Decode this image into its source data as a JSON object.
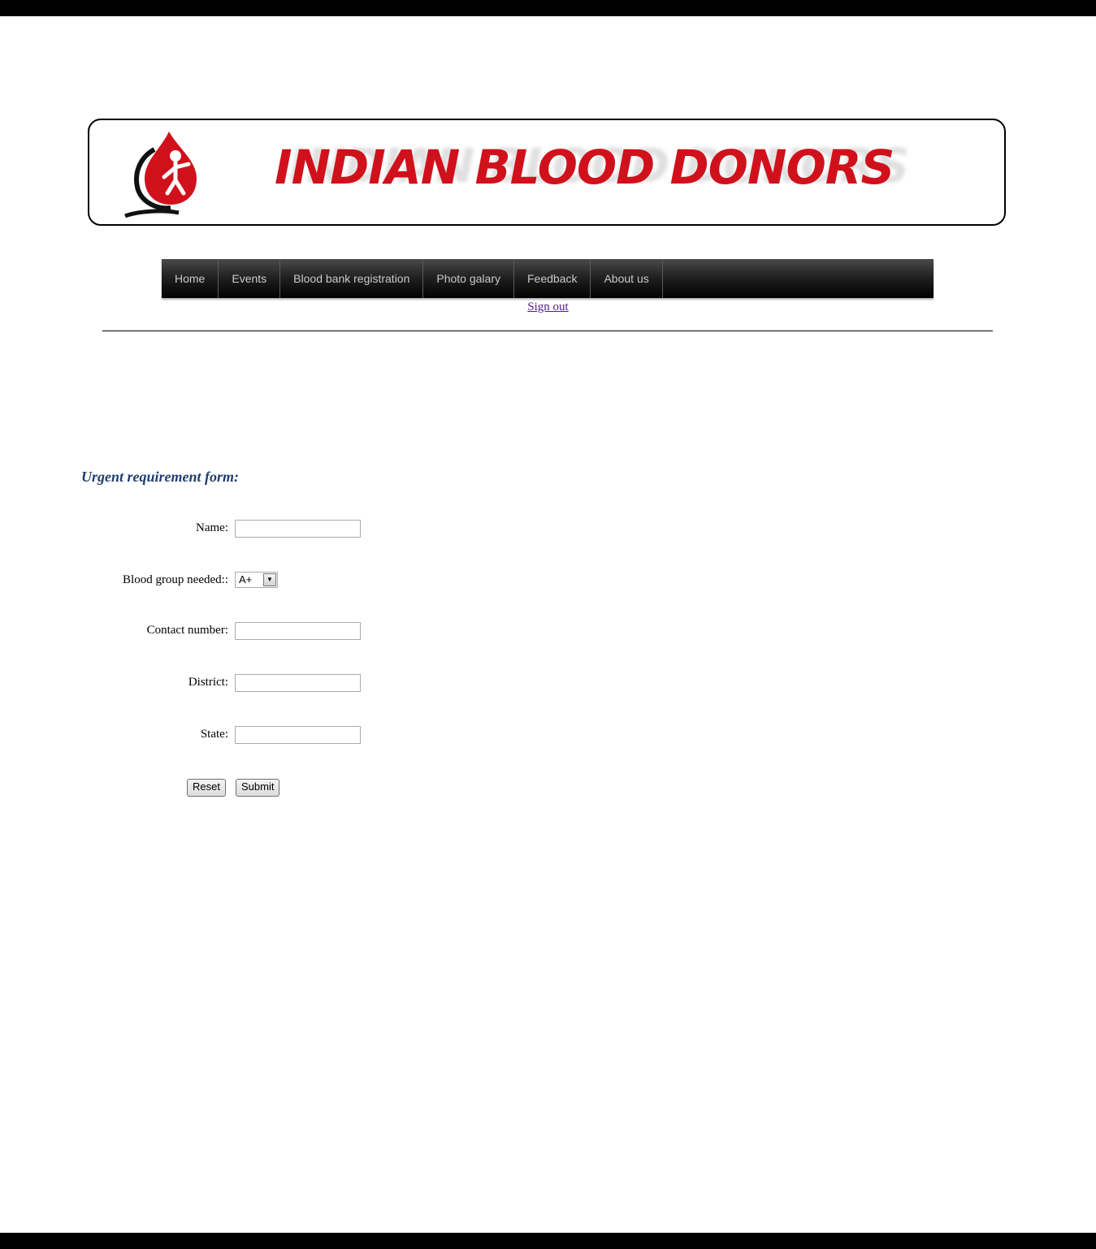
{
  "banner": {
    "title": "INDIAN BLOOD DONORS"
  },
  "nav": {
    "items": [
      {
        "label": "Home"
      },
      {
        "label": "Events"
      },
      {
        "label": "Blood bank registration"
      },
      {
        "label": "Photo galary"
      },
      {
        "label": "Feedback"
      },
      {
        "label": "About us"
      }
    ]
  },
  "sign_out": "Sign out",
  "form": {
    "title": "Urgent requirement form:",
    "name_label": "Name:",
    "name_value": "",
    "blood_group_label": "Blood group needed::",
    "blood_group_selected": "A+",
    "contact_label": "Contact number:",
    "contact_value": "",
    "district_label": "District:",
    "district_value": "",
    "state_label": "State:",
    "state_value": "",
    "reset_label": "Reset",
    "submit_label": "Submit"
  },
  "colors": {
    "brand_red": "#d0111b",
    "form_title": "#1f3e6e",
    "nav_background": "#1a1a1a",
    "link_visited": "#551a8b"
  },
  "icons": {
    "logo": "blood-drop-person-logo-icon",
    "select_arrow": "chevron-down-icon"
  }
}
